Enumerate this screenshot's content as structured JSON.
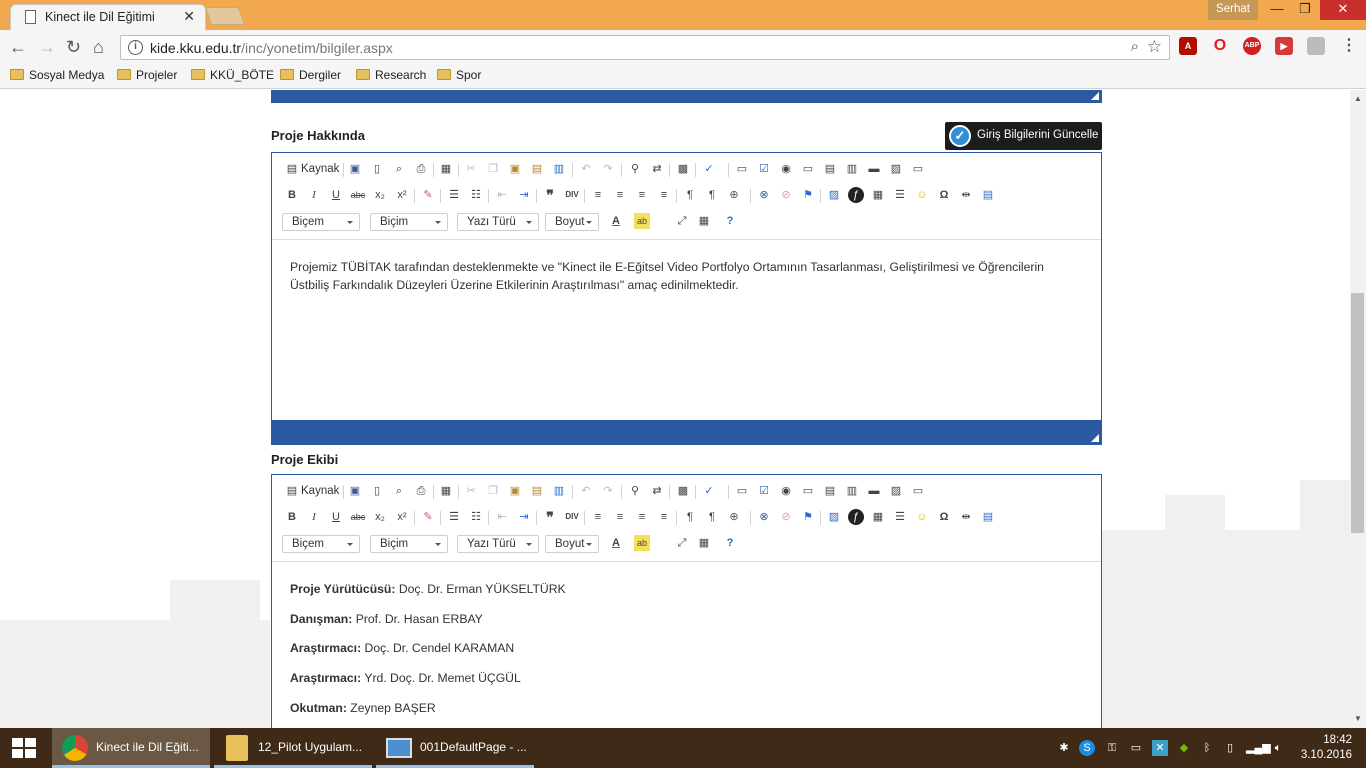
{
  "browser": {
    "tab_title": "Kinect ile Dil Eğitimi",
    "user": "Serhat",
    "url_host": "kide.kku.edu.tr",
    "url_path": "/inc/yonetim/bilgiler.aspx",
    "bookmarks": [
      "Sosyal Medya",
      "Projeler",
      "KKÜ_BÖTE",
      "Dergiler",
      "Research",
      "Spor"
    ],
    "extensions": [
      "ABP"
    ]
  },
  "page": {
    "update_button": "Giriş Bilgilerini Güncelle",
    "section1_title": "Proje Hakkında",
    "section2_title": "Proje Ekibi",
    "toolbar": {
      "source_label": "Kaynak",
      "combos": [
        "Biçem",
        "Biçim",
        "Yazı Türü",
        "Boyut"
      ],
      "icons": [
        "save-icon",
        "new-page-icon",
        "preview-icon",
        "print-icon",
        "templates-icon",
        "cut-icon",
        "copy-icon",
        "paste-icon",
        "paste-text-icon",
        "paste-word-icon",
        "undo-icon",
        "redo-icon",
        "find-icon",
        "replace-icon",
        "select-all-icon",
        "spellcheck-icon",
        "form-icon",
        "checkbox-icon",
        "radio-icon",
        "textfield-icon",
        "textarea-icon",
        "select-icon",
        "button-icon",
        "image-button-icon",
        "hidden-field-icon",
        "bold-icon",
        "italic-icon",
        "underline-icon",
        "strike-icon",
        "subscript-icon",
        "superscript-icon",
        "remove-format-icon",
        "numbered-list-icon",
        "bulleted-list-icon",
        "outdent-icon",
        "indent-icon",
        "blockquote-icon",
        "div-icon",
        "align-left-icon",
        "align-center-icon",
        "align-right-icon",
        "justify-icon",
        "ltr-icon",
        "rtl-icon",
        "language-icon",
        "link-icon",
        "unlink-icon",
        "anchor-icon",
        "image-icon",
        "flash-icon",
        "table-icon",
        "hr-icon",
        "smiley-icon",
        "special-char-icon",
        "page-break-icon",
        "iframe-icon",
        "text-color-icon",
        "bg-color-icon",
        "maximize-icon",
        "show-blocks-icon",
        "help-icon"
      ]
    },
    "about_text": "Projemiz TÜBİTAK tarafından desteklenmekte ve \"Kinect ile E-Eğitsel Video Portfolyo Ortamının Tasarlanması, Geliştirilmesi ve Öğrencilerin Üstbiliş Farkındalık Düzeyleri Üzerine Etkilerinin Araştırılması\" amaç edinilmektedir.",
    "team": [
      {
        "role": "Proje Yürütücüsü:",
        "name": "Doç. Dr. Erman YÜKSELTÜRK"
      },
      {
        "role": "Danışman:",
        "name": "Prof. Dr. Hasan ERBAY"
      },
      {
        "role": "Araştırmacı:",
        "name": "Doç. Dr. Cendel KARAMAN"
      },
      {
        "role": "Araştırmacı:",
        "name": "Yrd. Doç. Dr. Memet ÜÇGÜL"
      },
      {
        "role": "Okutman:",
        "name": "Zeynep BAŞER"
      }
    ]
  },
  "taskbar": {
    "tasks": [
      "Kinect ile Dil Eğiti...",
      "12_Pilot Uygulam...",
      "001DefaultPage - ..."
    ],
    "time": "18:42",
    "date": "3.10.2016"
  }
}
